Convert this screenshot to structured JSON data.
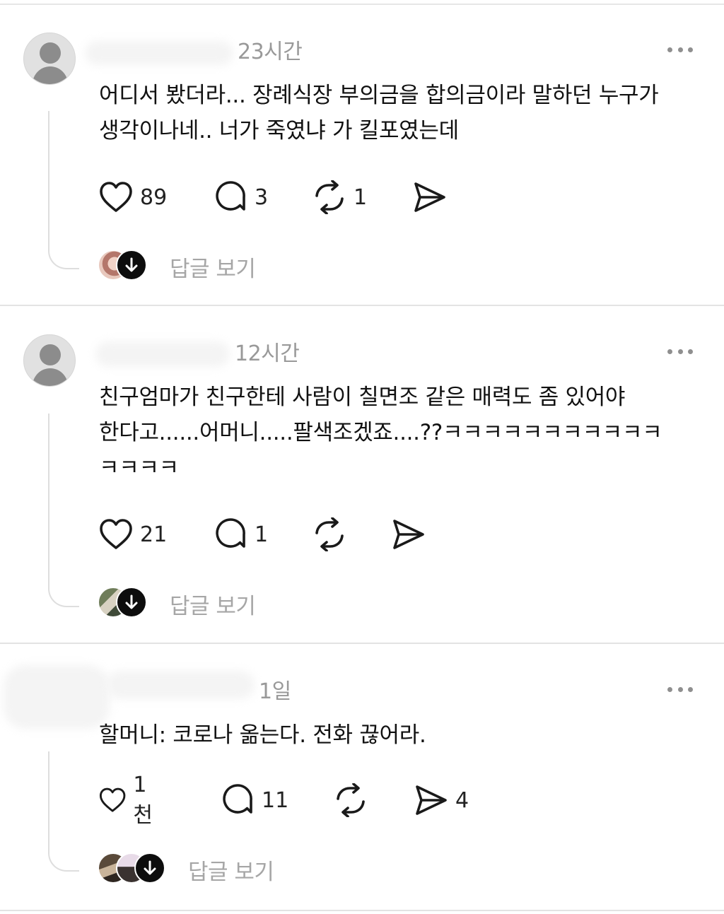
{
  "posts": [
    {
      "time": "23시간",
      "text": "어디서 봤더라... 장례식장 부의금을 합의금이라 말하던 누구가\n생각이나네.. 너가 죽였냐 가 킬포였는데",
      "likes": "89",
      "comments": "3",
      "reposts": "1",
      "shares": "",
      "view_replies": "답글 보기"
    },
    {
      "time": "12시간",
      "text": "친구엄마가 친구한테 사람이 칠면조 같은 매력도 좀 있어야\n한다고......어머니.....팔색조겠죠....??ㅋㅋㅋㅋㅋㅋㅋㅋㅋㅋㅋ\nㅋㅋㅋㅋ",
      "likes": "21",
      "comments": "1",
      "reposts": "",
      "shares": "",
      "view_replies": "답글 보기"
    },
    {
      "time": "1일",
      "text": "할머니: 코로나 옮는다. 전화 끊어라.",
      "likes": "1천",
      "comments": "11",
      "reposts": "",
      "shares": "4",
      "view_replies": "답글 보기"
    }
  ],
  "icons": {
    "more": "more-dots-icon",
    "like": "heart-icon",
    "comment": "comment-bubble-icon",
    "repost": "repost-arrows-icon",
    "share": "send-icon",
    "expand": "arrow-down-icon"
  }
}
